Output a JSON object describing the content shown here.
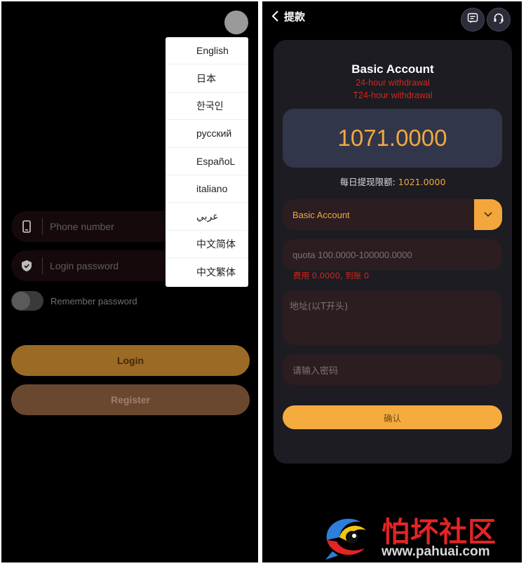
{
  "login": {
    "phone_placeholder": "Phone number",
    "password_placeholder": "Login password",
    "remember_label": "Remember password",
    "login_button": "Login",
    "register_button": "Register",
    "languages": [
      "English",
      "日本",
      "한국인",
      "русский",
      "EspañoL",
      "italiano",
      "عربي",
      "中文简体",
      "中文繁体"
    ]
  },
  "withdraw": {
    "header_title": "提款",
    "account_title": "Basic Account",
    "sub_line_1": "24-hour withdrawal",
    "sub_line_2": "T24-hour withdrawal",
    "balance": "1071.0000",
    "limit_label": "每日提现限额:",
    "limit_value": "1021.0000",
    "account_select": "Basic Account",
    "quota_placeholder": "quota 100.0000-100000.0000",
    "fee_text": "费用 0.0000, 到账 0",
    "address_placeholder": "地址(以T开头)",
    "password_placeholder": "请输入密码",
    "confirm_button": "确认"
  },
  "watermark": {
    "title": "怕坏社区",
    "url": "www.pahuai.com"
  },
  "colors": {
    "accent": "#f6ab3e",
    "error_red": "#d9231a",
    "login_button": "#9b6a24",
    "register_button": "#6a4830"
  }
}
